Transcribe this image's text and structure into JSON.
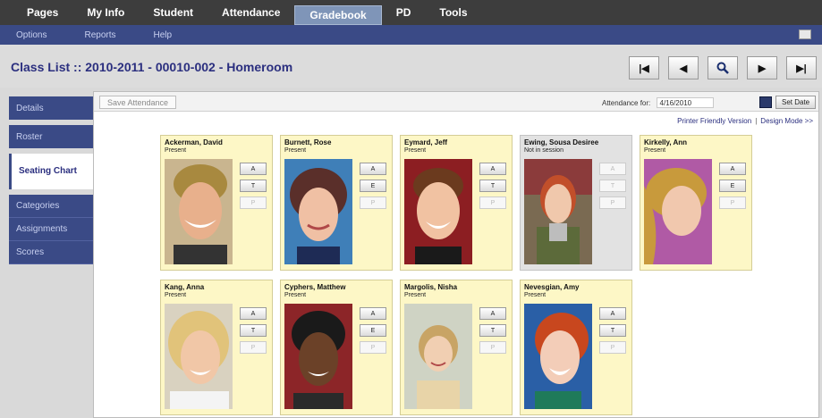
{
  "topnav": {
    "tabs": [
      "Pages",
      "My Info",
      "Student",
      "Attendance",
      "Gradebook",
      "PD",
      "Tools"
    ],
    "active": "Gradebook"
  },
  "subnav": {
    "items": [
      "Options",
      "Reports",
      "Help"
    ]
  },
  "title": "Class List :: 2010-2011 - 00010-002 - Homeroom",
  "nav_buttons": [
    "first-icon",
    "previous-icon",
    "search-icon",
    "next-icon",
    "last-icon"
  ],
  "sidebar": {
    "items": [
      {
        "label": "Details"
      },
      {
        "label": "Roster"
      },
      {
        "label": "Seating Chart",
        "active": true
      },
      {
        "label": "Categories"
      },
      {
        "label": "Assignments"
      },
      {
        "label": "Scores"
      }
    ]
  },
  "toolbar": {
    "save_label": "Save Attendance",
    "attendance_label": "Attendance for:",
    "attendance_date": "4/16/2010",
    "set_date_label": "Set Date"
  },
  "links": {
    "printer": "Printer Friendly Version",
    "separator": "|",
    "design": "Design Mode >>"
  },
  "students": [
    {
      "name": "Ackerman, David",
      "status": "Present",
      "buttons": [
        "A",
        "T",
        "P"
      ]
    },
    {
      "name": "Burnett, Rose",
      "status": "Present",
      "buttons": [
        "A",
        "E",
        "P"
      ]
    },
    {
      "name": "Eymard, Jeff",
      "status": "Present",
      "buttons": [
        "A",
        "T",
        "P"
      ]
    },
    {
      "name": "Ewing, Sousa Desiree",
      "status": "Not in session",
      "buttons": [
        "A",
        "T",
        "P"
      ]
    },
    {
      "name": "Kirkelly, Ann",
      "status": "Present",
      "buttons": [
        "A",
        "E",
        "P"
      ]
    },
    {
      "name": "Kang, Anna",
      "status": "Present",
      "buttons": [
        "A",
        "T",
        "P"
      ]
    },
    {
      "name": "Cyphers, Matthew",
      "status": "Present",
      "buttons": [
        "A",
        "E",
        "P"
      ]
    },
    {
      "name": "Margolis, Nisha",
      "status": "Present",
      "buttons": [
        "A",
        "T",
        "P"
      ]
    },
    {
      "name": "Nevesgian, Amy",
      "status": "Present",
      "buttons": [
        "A",
        "T",
        "P"
      ]
    }
  ],
  "colors": {
    "topnav": "#3d3d3d",
    "subnav": "#3a4a86",
    "title": "#2b2f7f",
    "card": "#fdf7c6",
    "card_inactive": "#e2e2e2"
  }
}
